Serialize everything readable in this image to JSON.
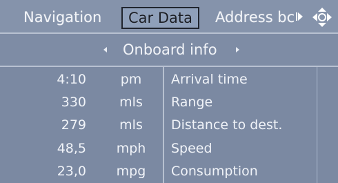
{
  "tabs": [
    {
      "label": "Navigation"
    },
    {
      "label": "Car Data"
    },
    {
      "label": "Address bc"
    }
  ],
  "subheader": {
    "title": "Onboard info"
  },
  "rows": [
    {
      "value": "4:10",
      "unit": "pm",
      "label": "Arrival time"
    },
    {
      "value": "330",
      "unit": "mls",
      "label": "Range"
    },
    {
      "value": "279",
      "unit": "mls",
      "label": "Distance to dest."
    },
    {
      "value": "48,5",
      "unit": "mph",
      "label": "Speed"
    },
    {
      "value": "23,0",
      "unit": "mpg",
      "label": "Consumption"
    }
  ],
  "icons": {
    "tab_scroll": "right-arrow-icon",
    "controller": "controller-icon",
    "sub_prev": "left-arrow-icon",
    "sub_next": "right-arrow-icon"
  }
}
